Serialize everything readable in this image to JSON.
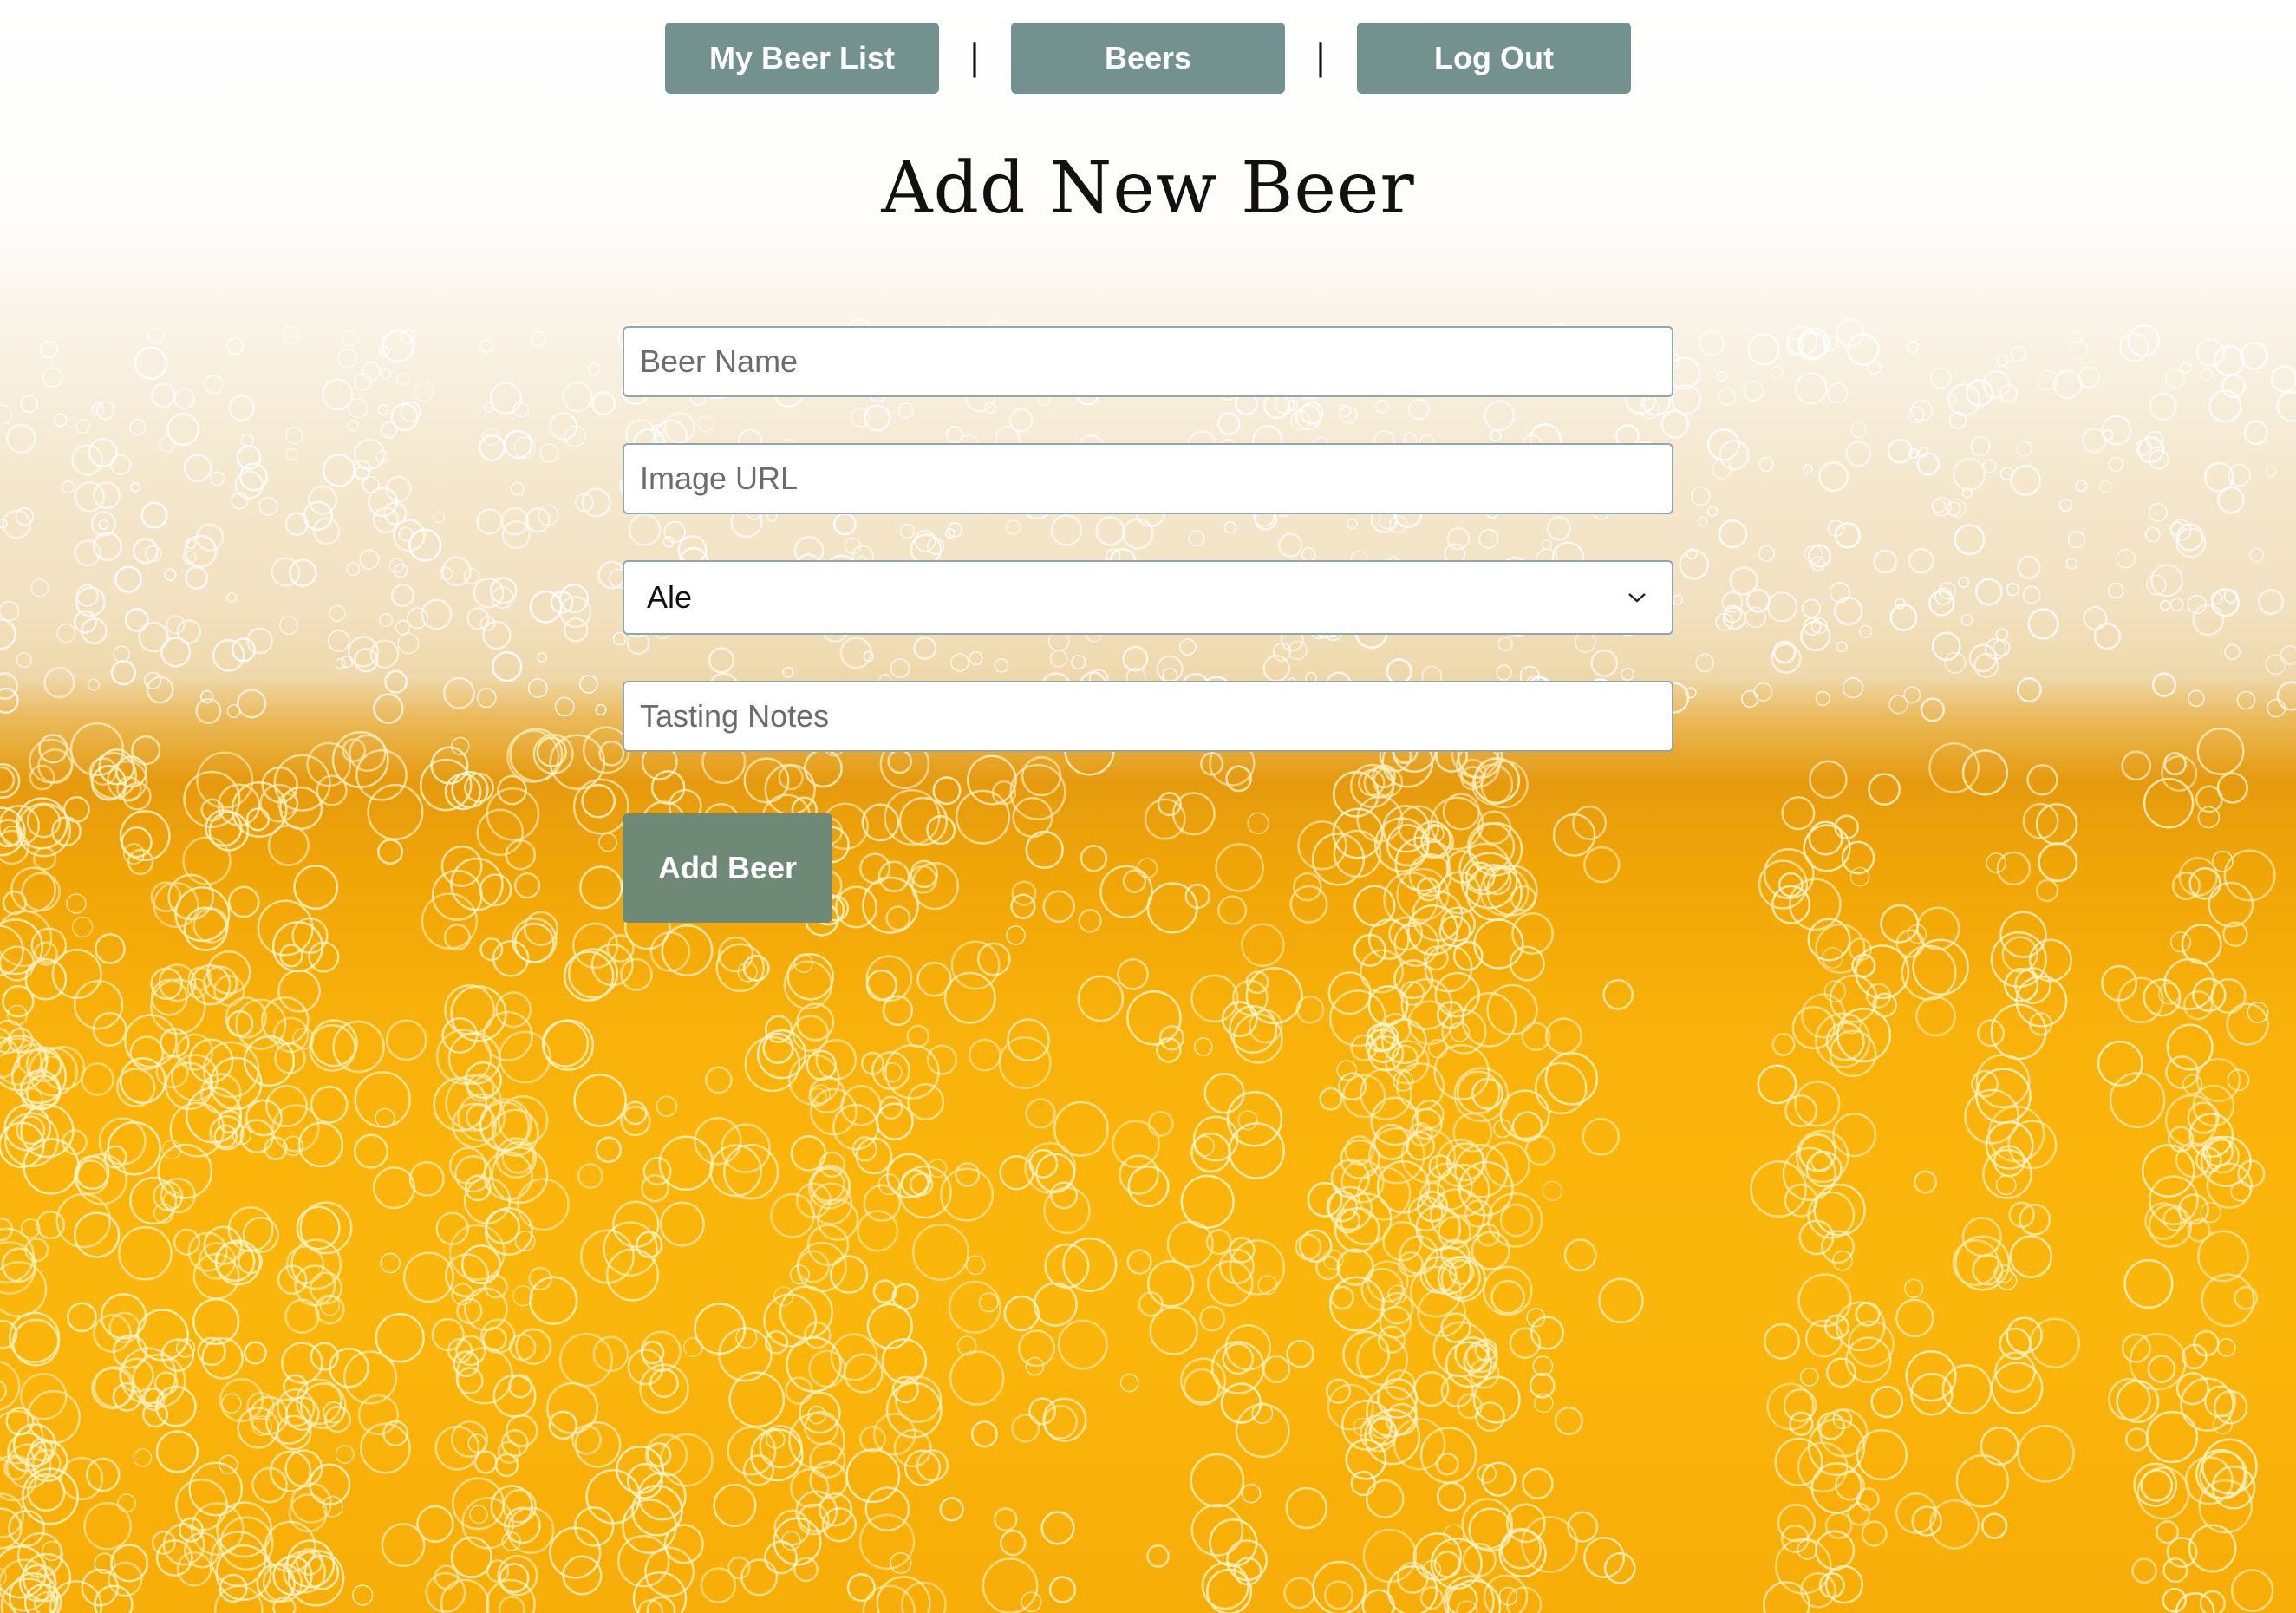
{
  "nav": {
    "items": [
      {
        "label": "My Beer List"
      },
      {
        "label": "Beers"
      },
      {
        "label": "Log Out"
      }
    ],
    "separator": "|"
  },
  "page": {
    "title": "Add New Beer"
  },
  "form": {
    "beer_name": {
      "placeholder": "Beer Name",
      "value": ""
    },
    "image_url": {
      "placeholder": "Image URL",
      "value": ""
    },
    "beer_type": {
      "selected": "Ale"
    },
    "tasting_notes": {
      "placeholder": "Tasting Notes",
      "value": ""
    },
    "submit_label": "Add Beer"
  },
  "colors": {
    "nav_button": "#72918f",
    "submit_button": "#6e8a76",
    "beer_gold": "#fbb60b",
    "foam": "#f4e7cc"
  }
}
